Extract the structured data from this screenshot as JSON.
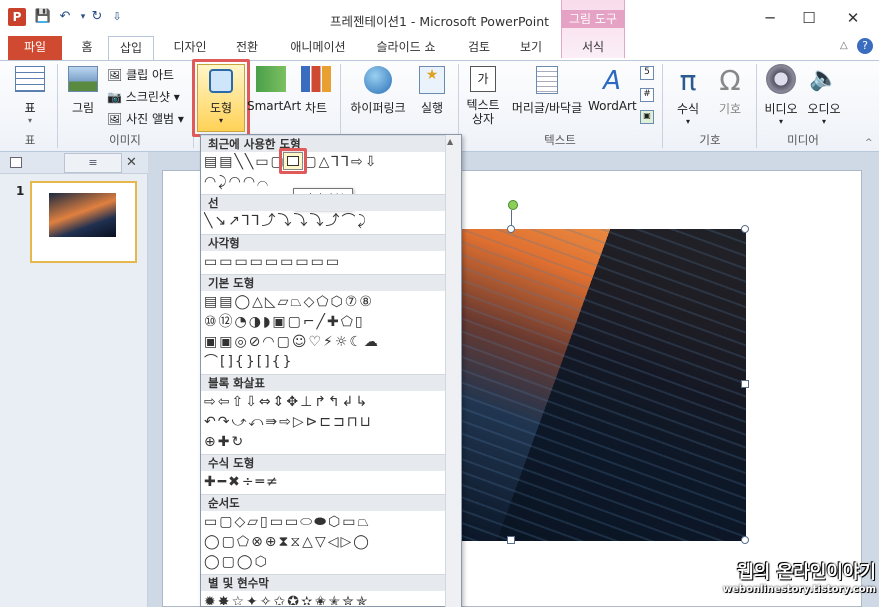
{
  "app": {
    "title": "프레젠테이션1 - Microsoft PowerPoint",
    "context_group": "그림 도구"
  },
  "tabs": [
    "파일",
    "홈",
    "삽입",
    "디자인",
    "전환",
    "애니메이션",
    "슬라이드 쇼",
    "검토",
    "보기",
    "서식"
  ],
  "ribbon": {
    "buttons": {
      "table": "표",
      "picture": "그림",
      "clipart": "클립 아트",
      "screenshot": "스크린샷",
      "photo_album": "사진 앨범",
      "shapes": "도형",
      "smartart": "SmartArt",
      "chart": "차트",
      "hyperlink": "하이퍼링크",
      "action": "실행",
      "textbox": "텍스트\n상자",
      "header_footer": "머리글/바닥글",
      "wordart": "WordArt",
      "equation": "수식",
      "symbol": "기호",
      "video": "비디오",
      "audio": "오디오"
    },
    "groups": [
      "표",
      "이미지",
      "텍스트",
      "기호",
      "미디어"
    ]
  },
  "slide_panel": {
    "slide_number": "1"
  },
  "shapes_panel": {
    "sections": [
      "최근에 사용한 도형",
      "선",
      "사각형",
      "기본 도형",
      "블록 화살표",
      "수식 도형",
      "순서도",
      "별 및 현수막"
    ],
    "tooltip": "직사각형"
  },
  "watermark": {
    "line1": "웹의 온라인이야기",
    "line2": "webonlinestory.tistory.com"
  },
  "colors": {
    "file_tab": "#d04a31",
    "context_tab": "#e5a2c4",
    "highlight": "#e05a5a"
  }
}
